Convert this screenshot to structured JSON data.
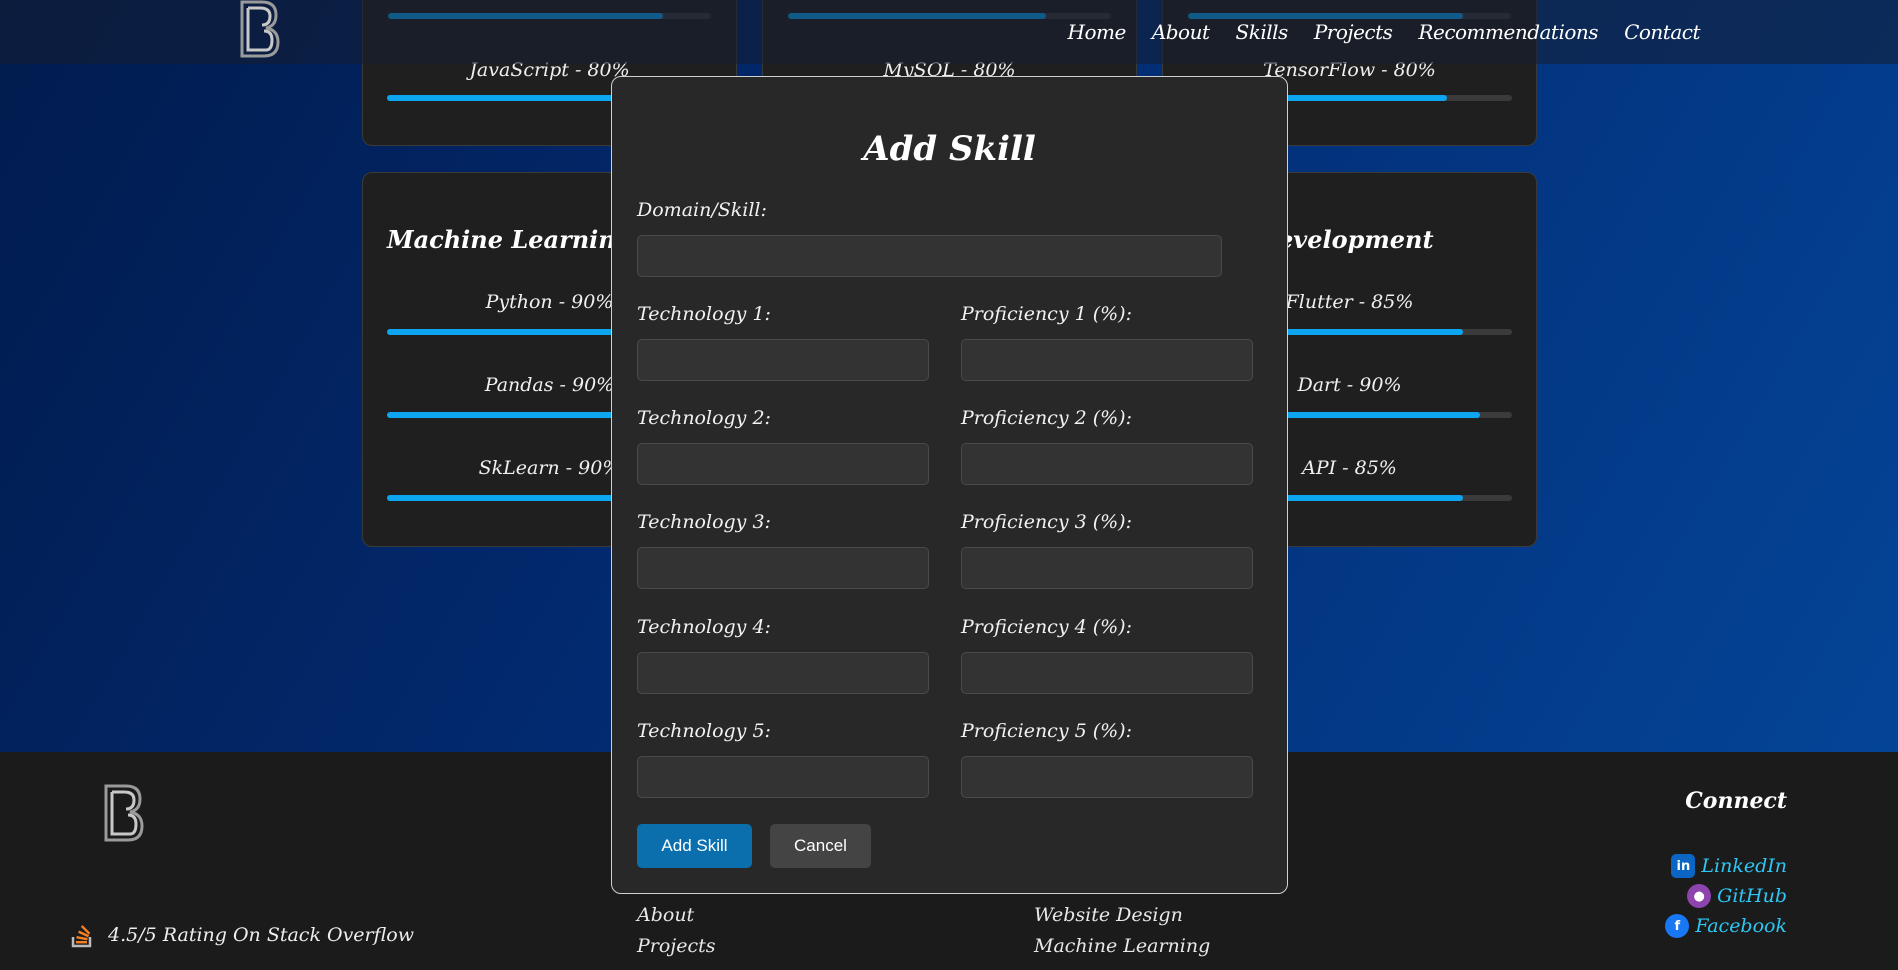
{
  "nav": {
    "links": [
      "Home",
      "About",
      "Skills",
      "Projects",
      "Recommendations",
      "Contact"
    ]
  },
  "cards": {
    "top_left": {
      "skill_label": "JavaScript - 80%",
      "value": 80,
      "top_bar_value": 85
    },
    "top_middle": {
      "skill_label": "MySQL - 80%",
      "top_bar_value": 80
    },
    "top_right": {
      "skill_label": "TensorFlow - 80%",
      "value": 80,
      "top_bar_value": 85
    },
    "ml": {
      "title": "Machine Learning",
      "skills": [
        {
          "label": "Python - 90%",
          "value": 90
        },
        {
          "label": "Pandas - 90%",
          "value": 90
        },
        {
          "label": "SkLearn - 90%",
          "value": 90
        }
      ]
    },
    "dev": {
      "title": "evelopment",
      "skills": [
        {
          "label": "Flutter - 85%",
          "value": 85
        },
        {
          "label": "Dart - 90%",
          "value": 90
        },
        {
          "label": "API - 85%",
          "value": 85
        }
      ]
    }
  },
  "modal": {
    "title": "Add Skill",
    "domain_label": "Domain/Skill:",
    "rows": [
      {
        "tech_label": "Technology 1:",
        "prof_label": "Proficiency 1 (%):"
      },
      {
        "tech_label": "Technology 2:",
        "prof_label": "Proficiency 2 (%):"
      },
      {
        "tech_label": "Technology 3:",
        "prof_label": "Proficiency 3 (%):"
      },
      {
        "tech_label": "Technology 4:",
        "prof_label": "Proficiency 4 (%):"
      },
      {
        "tech_label": "Technology 5:",
        "prof_label": "Proficiency 5 (%):"
      }
    ],
    "submit_label": "Add Skill",
    "cancel_label": "Cancel"
  },
  "footer": {
    "connect_title": "Connect",
    "socials": [
      {
        "label": "LinkedIn",
        "icon": "linkedin-icon",
        "color": "#0a66c2"
      },
      {
        "label": "GitHub",
        "icon": "github-icon",
        "color": "#8e44ad"
      },
      {
        "label": "Facebook",
        "icon": "facebook-icon",
        "color": "#1877f2"
      }
    ],
    "links_col1": [
      "About",
      "Projects"
    ],
    "links_col2": [
      "Website Design",
      "Machine Learning"
    ],
    "rating_text": "4.5/5 Rating On Stack Overflow"
  },
  "colors": {
    "accent_bar": "#0ea5f0",
    "primary_button": "#0b6fae",
    "link": "#2ec7f5"
  }
}
